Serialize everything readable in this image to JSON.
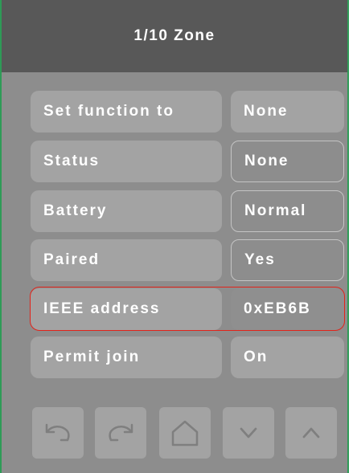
{
  "header": {
    "title": "1/10 Zone"
  },
  "rows": [
    {
      "label": "Set function to",
      "value": "None"
    },
    {
      "label": "Status",
      "value": "None"
    },
    {
      "label": "Battery",
      "value": "Normal"
    },
    {
      "label": "Paired",
      "value": "Yes"
    },
    {
      "label": "IEEE address",
      "value": "0xEB6B"
    },
    {
      "label": "Permit join",
      "value": "On"
    }
  ],
  "nav": [
    {
      "icon": "undo-icon"
    },
    {
      "icon": "redo-icon"
    },
    {
      "icon": "home-icon"
    },
    {
      "icon": "chevron-down-icon"
    },
    {
      "icon": "chevron-up-icon"
    }
  ],
  "colors": {
    "header_bg": "#585858",
    "panel_bg": "#8d8d8d",
    "button_bg": "#a3a3a3",
    "highlight": "#e2231a",
    "frame": "#2e9b57"
  }
}
